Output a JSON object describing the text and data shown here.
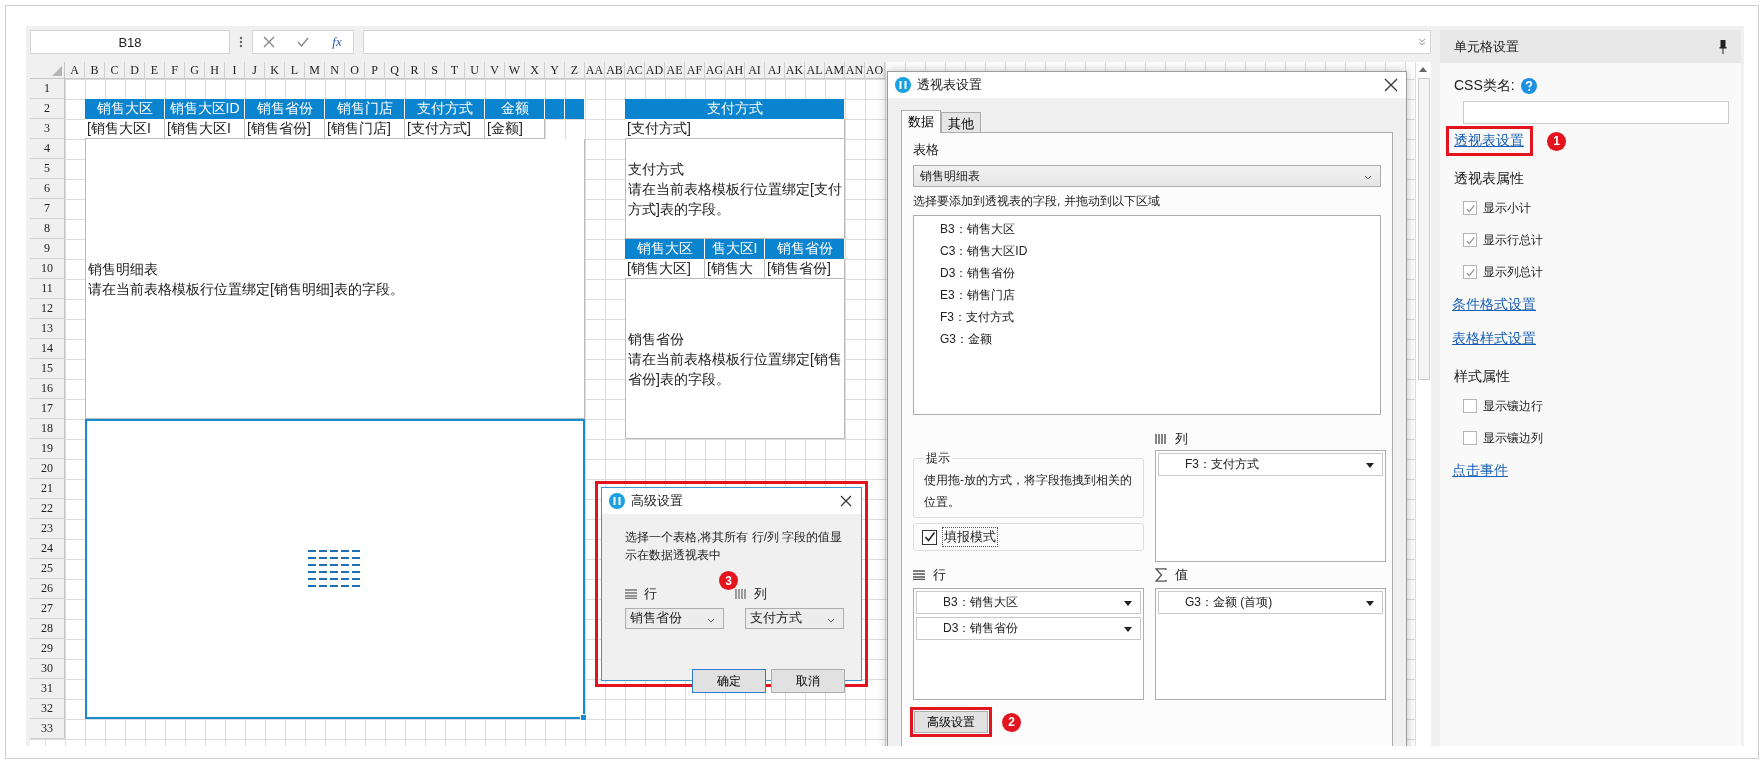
{
  "formula_bar": {
    "cell_ref": "B18",
    "fx_label": "fx"
  },
  "column_headers": [
    "A",
    "B",
    "C",
    "D",
    "E",
    "F",
    "G",
    "H",
    "I",
    "J",
    "K",
    "L",
    "M",
    "N",
    "O",
    "P",
    "Q",
    "R",
    "S",
    "T",
    "U",
    "V",
    "W",
    "X",
    "Y",
    "Z",
    "AA",
    "AB",
    "AC",
    "AD",
    "AE",
    "AF",
    "AG",
    "AH",
    "AI",
    "AJ",
    "AK",
    "AL",
    "AM",
    "AN",
    "AO"
  ],
  "row_numbers": [
    "1",
    "2",
    "3",
    "4",
    "5",
    "6",
    "7",
    "8",
    "9",
    "10",
    "11",
    "12",
    "13",
    "14",
    "15",
    "16",
    "17",
    "18",
    "19",
    "20",
    "21",
    "22",
    "23",
    "24",
    "25",
    "26",
    "27",
    "28",
    "29",
    "30",
    "31",
    "32",
    "33"
  ],
  "detail_table": {
    "headers": [
      "销售大区",
      "销售大区ID",
      "销售省份",
      "销售门店",
      "支付方式",
      "金额"
    ],
    "fields": [
      "[销售大区I",
      "[销售大区I",
      "[销售省份]",
      "[销售门店]",
      "[支付方式]",
      "[金额]"
    ],
    "title": "销售明细表",
    "note": "请在当前表格模板行位置绑定[销售明细]表的字段。"
  },
  "payment_table": {
    "headers": [
      "支付方式"
    ],
    "fields": [
      "[支付方式]"
    ],
    "title": "支付方式",
    "note": "请在当前表格模板行位置绑定[支付方式]表的字段。"
  },
  "province_table": {
    "headers": [
      "销售大区",
      "售大区I",
      "销售省份"
    ],
    "fields": [
      "[销售大区]",
      "[销售大",
      "[销售省份]"
    ],
    "title": "销售省份",
    "note": "请在当前表格模板行位置绑定[销售省份]表的字段。"
  },
  "pivot_dialog": {
    "title": "透视表设置",
    "tabs": [
      {
        "label": "数据",
        "selected": true
      },
      {
        "label": "其他",
        "selected": false
      }
    ],
    "table_label": "表格",
    "table_value": "销售明细表",
    "instruction": "选择要添加到透视表的字段, 并拖动到以下区域",
    "fields": [
      "B3：销售大区",
      "C3：销售大区ID",
      "D3：销售省份",
      "E3：销售门店",
      "F3：支付方式",
      "G3：金额"
    ],
    "hint_title": "提示",
    "hint": "使用拖-放的方式，将字段拖拽到相关的位置。",
    "fill_mode": {
      "label": "填报模式",
      "checked": true
    },
    "columns_label": "列",
    "columns": [
      "F3：支付方式"
    ],
    "rows_label": "行",
    "rows": [
      "B3：销售大区",
      "D3：销售省份"
    ],
    "values_label": "值",
    "values": [
      "G3：金额 (首项)"
    ],
    "advanced_button": "高级设置",
    "callout": "2"
  },
  "advanced_dialog": {
    "title": "高级设置",
    "description": "选择一个表格,将其所有 行/列 字段的值显示在数据透视表中",
    "row_label": "行",
    "row_value": "销售省份",
    "column_label": "列",
    "column_value": "支付方式",
    "ok": "确定",
    "cancel": "取消",
    "callout": "3"
  },
  "cell_panel": {
    "title": "单元格设置",
    "css_label": "CSS类名:",
    "items": [
      {
        "kind": "link",
        "label": "透视表设置",
        "callout": "1"
      },
      {
        "kind": "heading",
        "label": "透视表属性"
      },
      {
        "kind": "checkbox",
        "label": "显示小计",
        "checked": true
      },
      {
        "kind": "checkbox",
        "label": "显示行总计",
        "checked": true
      },
      {
        "kind": "checkbox",
        "label": "显示列总计",
        "checked": true
      },
      {
        "kind": "link",
        "label": "条件格式设置"
      },
      {
        "kind": "link",
        "label": "表格样式设置"
      },
      {
        "kind": "heading",
        "label": "样式属性"
      },
      {
        "kind": "checkbox",
        "label": "显示镶边行",
        "checked": false
      },
      {
        "kind": "checkbox",
        "label": "显示镶边列",
        "checked": false
      },
      {
        "kind": "link",
        "label": "点击事件"
      }
    ]
  }
}
